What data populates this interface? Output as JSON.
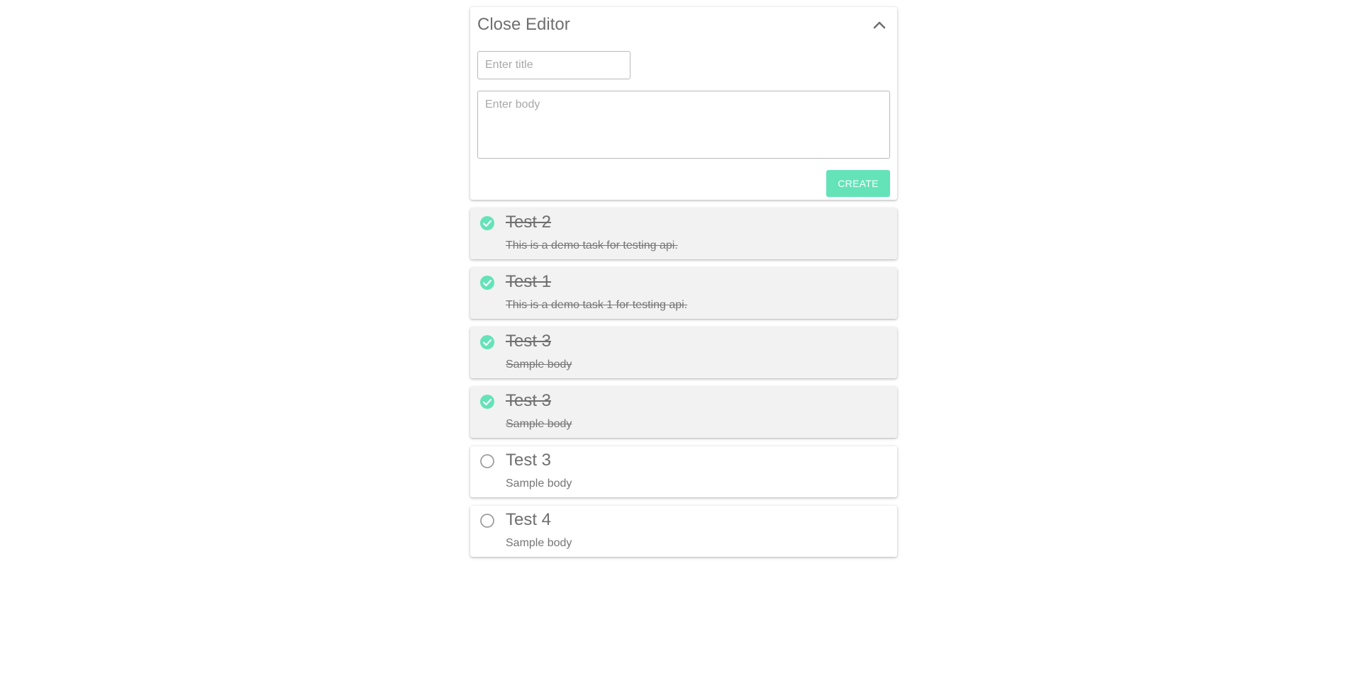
{
  "editor": {
    "toggle_label": "Close Editor",
    "toggle_icon": "chevron-up-icon",
    "title_placeholder": "Enter title",
    "body_placeholder": "Enter body",
    "create_label": "CREATE"
  },
  "colors": {
    "accent": "#64e3b8",
    "done_background": "#f2f2f2",
    "open_background": "#ffffff",
    "unchecked_circle": "#9e9e9e"
  },
  "tasks": [
    {
      "title": "Test 2",
      "body": "This is a demo task for testing api.",
      "done": true
    },
    {
      "title": "Test 1",
      "body": "This is a demo task 1 for testing api.",
      "done": true
    },
    {
      "title": "Test 3",
      "body": "Sample body",
      "done": true
    },
    {
      "title": "Test 3",
      "body": "Sample body",
      "done": true
    },
    {
      "title": "Test 3",
      "body": "Sample body",
      "done": false
    },
    {
      "title": "Test 4",
      "body": "Sample body",
      "done": false
    }
  ]
}
